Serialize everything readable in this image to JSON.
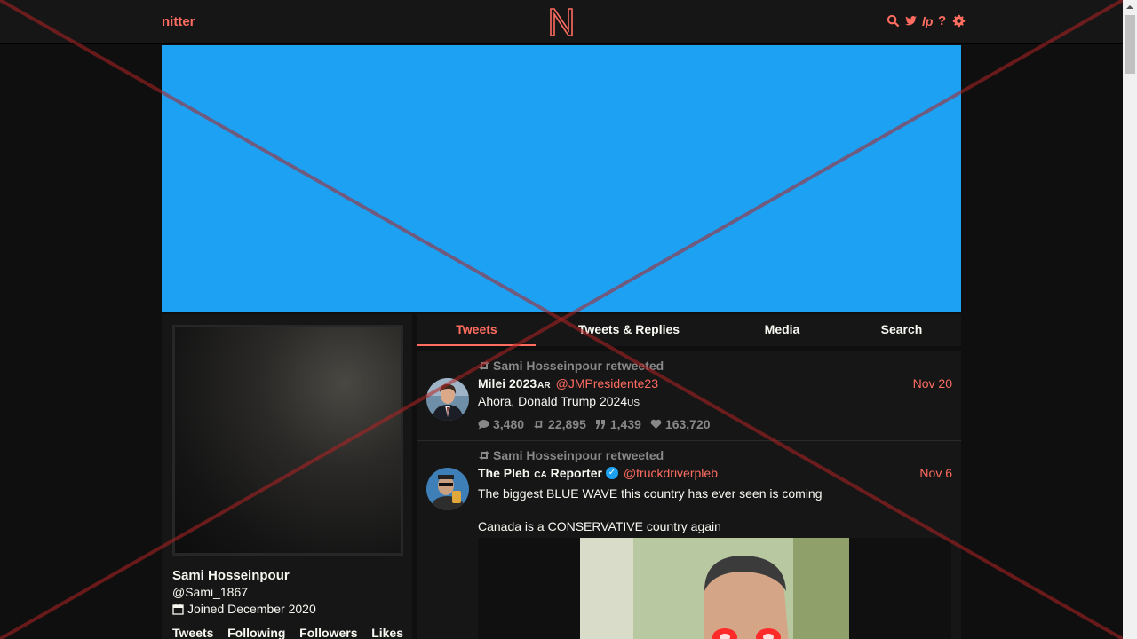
{
  "nav": {
    "brand": "nitter",
    "logo_letter": "N",
    "icons": [
      "search-icon",
      "twitter-icon",
      "lp-icon",
      "help-icon",
      "gear-icon"
    ],
    "lp_glyph": "lp",
    "help_glyph": "?"
  },
  "colors": {
    "accent": "#ff6c60",
    "banner": "#1da1f2",
    "background": "#0f0f0f",
    "panel": "#161616",
    "muted": "#888889",
    "overlay_cross": "#b22222"
  },
  "profile": {
    "fullname": "Sami Hosseinpour",
    "username": "@Sami_1867",
    "joined": "Joined December 2020",
    "stats": [
      "Tweets",
      "Following",
      "Followers",
      "Likes"
    ]
  },
  "tabs": [
    "Tweets",
    "Tweets & Replies",
    "Media",
    "Search"
  ],
  "active_tab": "Tweets",
  "timeline": [
    {
      "retweet_header": "Sami Hosseinpour retweeted",
      "fullname": "Milei 2023",
      "fullname_badge": "AR",
      "username": "@JMPresidente23",
      "date": "Nov 20",
      "text": "Ahora, Donald Trump 2024",
      "text_suffix": "US",
      "replies": "3,480",
      "retweets": "22,895",
      "quotes": "1,439",
      "likes": "163,720"
    },
    {
      "retweet_header": "Sami Hosseinpour retweeted",
      "fullname": "The Pleb",
      "fullname_badge": "CA",
      "fullname_tail": "Reporter",
      "verified": true,
      "username": "@truckdriverpleb",
      "date": "Nov 6",
      "text_line1": "The biggest BLUE WAVE this country has ever seen is coming",
      "text_line2": "Canada is a CONSERVATIVE country again"
    }
  ]
}
